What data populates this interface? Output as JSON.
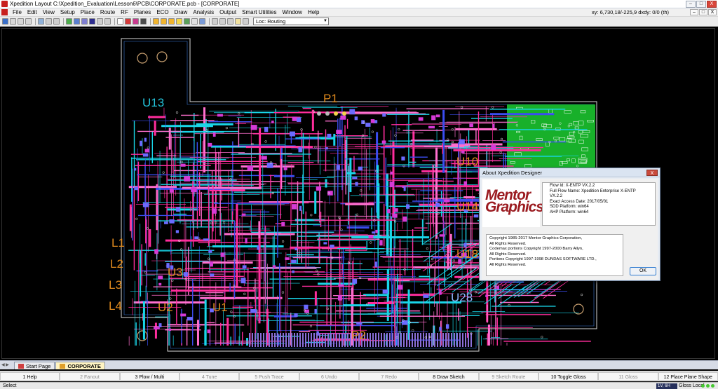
{
  "window": {
    "title": "Xpedition Layout  C:\\Xpedition_Evaluation\\Lesson6\\PCB\\CORPORATE.pcb - [CORPORATE]",
    "minimize": "–",
    "maximize": "□",
    "close": "X"
  },
  "menu": {
    "items": [
      "File",
      "Edit",
      "View",
      "Setup",
      "Place",
      "Route",
      "RF",
      "Planes",
      "ECO",
      "Draw",
      "Analysis",
      "Output",
      "Smart Utilities",
      "Window",
      "Help"
    ],
    "coords": "xy: 6,730,18/-225,9  dxdy: 0/0  (th)"
  },
  "toolbar": {
    "scheme": "Loc: Routing"
  },
  "pcb": {
    "labels": {
      "p1": "P1",
      "p2": "P2",
      "u13": "U13",
      "u10": "U10",
      "u14": "U14",
      "u18": "U18",
      "u28": "U28",
      "u3": "U3",
      "u2": "U2",
      "u1": "U1",
      "l1": "L1",
      "l2": "L2",
      "l3": "L3",
      "l4": "L4"
    }
  },
  "about_dialog": {
    "title": "About Xpedition Designer",
    "close": "X",
    "logo_line1": "Mentor",
    "logo_line2": "Graphics",
    "info": [
      "Flow Id: X-ENTP VX.2.2",
      "Full Flow Name: Xpedition Enterprise X-ENTP",
      "VX.2.2",
      "Exact Access Date: 2017/05/01",
      "SDD Platform: win64",
      "AHP Platform: win64"
    ],
    "copyright": [
      "Copyright 1985-2017 Mentor Graphics Corporation,",
      "All Rights Reserved.",
      "Codemax portions Copyright 1997-2000 Barry Allyn,",
      "All Rights Reserved.",
      "Portions Copyright 1997-1998 DUNDAS SOFTWARE LTD.,",
      "All Rights Reserved."
    ],
    "ok": "OK"
  },
  "tabs": [
    {
      "label": "Start Page",
      "active": false
    },
    {
      "label": "CORPORATE",
      "active": true
    }
  ],
  "function_keys": [
    {
      "label": "1 Help",
      "enabled": true
    },
    {
      "label": "2 Fanout",
      "enabled": false
    },
    {
      "label": "3 Plow / Multi",
      "enabled": true
    },
    {
      "label": "4 Tune",
      "enabled": false
    },
    {
      "label": "5 Push Trace",
      "enabled": false
    },
    {
      "label": "6 Undo",
      "enabled": false
    },
    {
      "label": "7 Redo",
      "enabled": false
    },
    {
      "label": "8 Draw Sketch",
      "enabled": true
    },
    {
      "label": "9 Sketch Route",
      "enabled": false
    },
    {
      "label": "10 Toggle Gloss",
      "enabled": true
    },
    {
      "label": "11 Gloss",
      "enabled": false
    },
    {
      "label": "12 Place Plane Shape",
      "enabled": true
    }
  ],
  "status": {
    "left": "Select",
    "layer": "1V, 6H",
    "gloss": "Gloss Local"
  },
  "colors": {
    "trace_pink": "#ff2d9c",
    "trace_cyan": "#19d6e8",
    "trace_blue": "#3b4df0",
    "plane_green": "#18b02a",
    "label_orange": "#e08a1e",
    "logo_red": "#9b1b20"
  }
}
